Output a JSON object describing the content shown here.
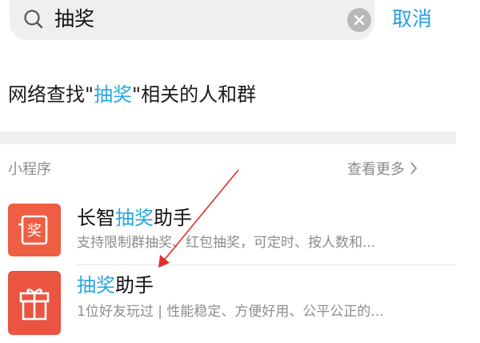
{
  "search": {
    "query": "抽奖",
    "clear_icon": "clear-x-icon",
    "cancel_label": "取消"
  },
  "network_search": {
    "prefix": "网络查找\"",
    "keyword": "抽奖",
    "suffix": "\"相关的人和群"
  },
  "section": {
    "title": "小程序",
    "view_more": "查看更多"
  },
  "items": [
    {
      "name_pre": "长智",
      "name_hl": "抽奖",
      "name_post": "助手",
      "description": "支持限制群抽奖、红包抽奖，可定时、按人数和...",
      "icon": "lottery-ticket-icon",
      "icon_color": "#ef5e43"
    },
    {
      "name_pre": "",
      "name_hl": "抽奖",
      "name_post": "助手",
      "description": "1位好友玩过 | 性能稳定、方便好用、公平公正的...",
      "icon": "gift-box-icon",
      "icon_color": "#ea5441"
    }
  ],
  "colors": {
    "accent": "#28a6e2",
    "annotation_arrow": "#e0302a"
  }
}
